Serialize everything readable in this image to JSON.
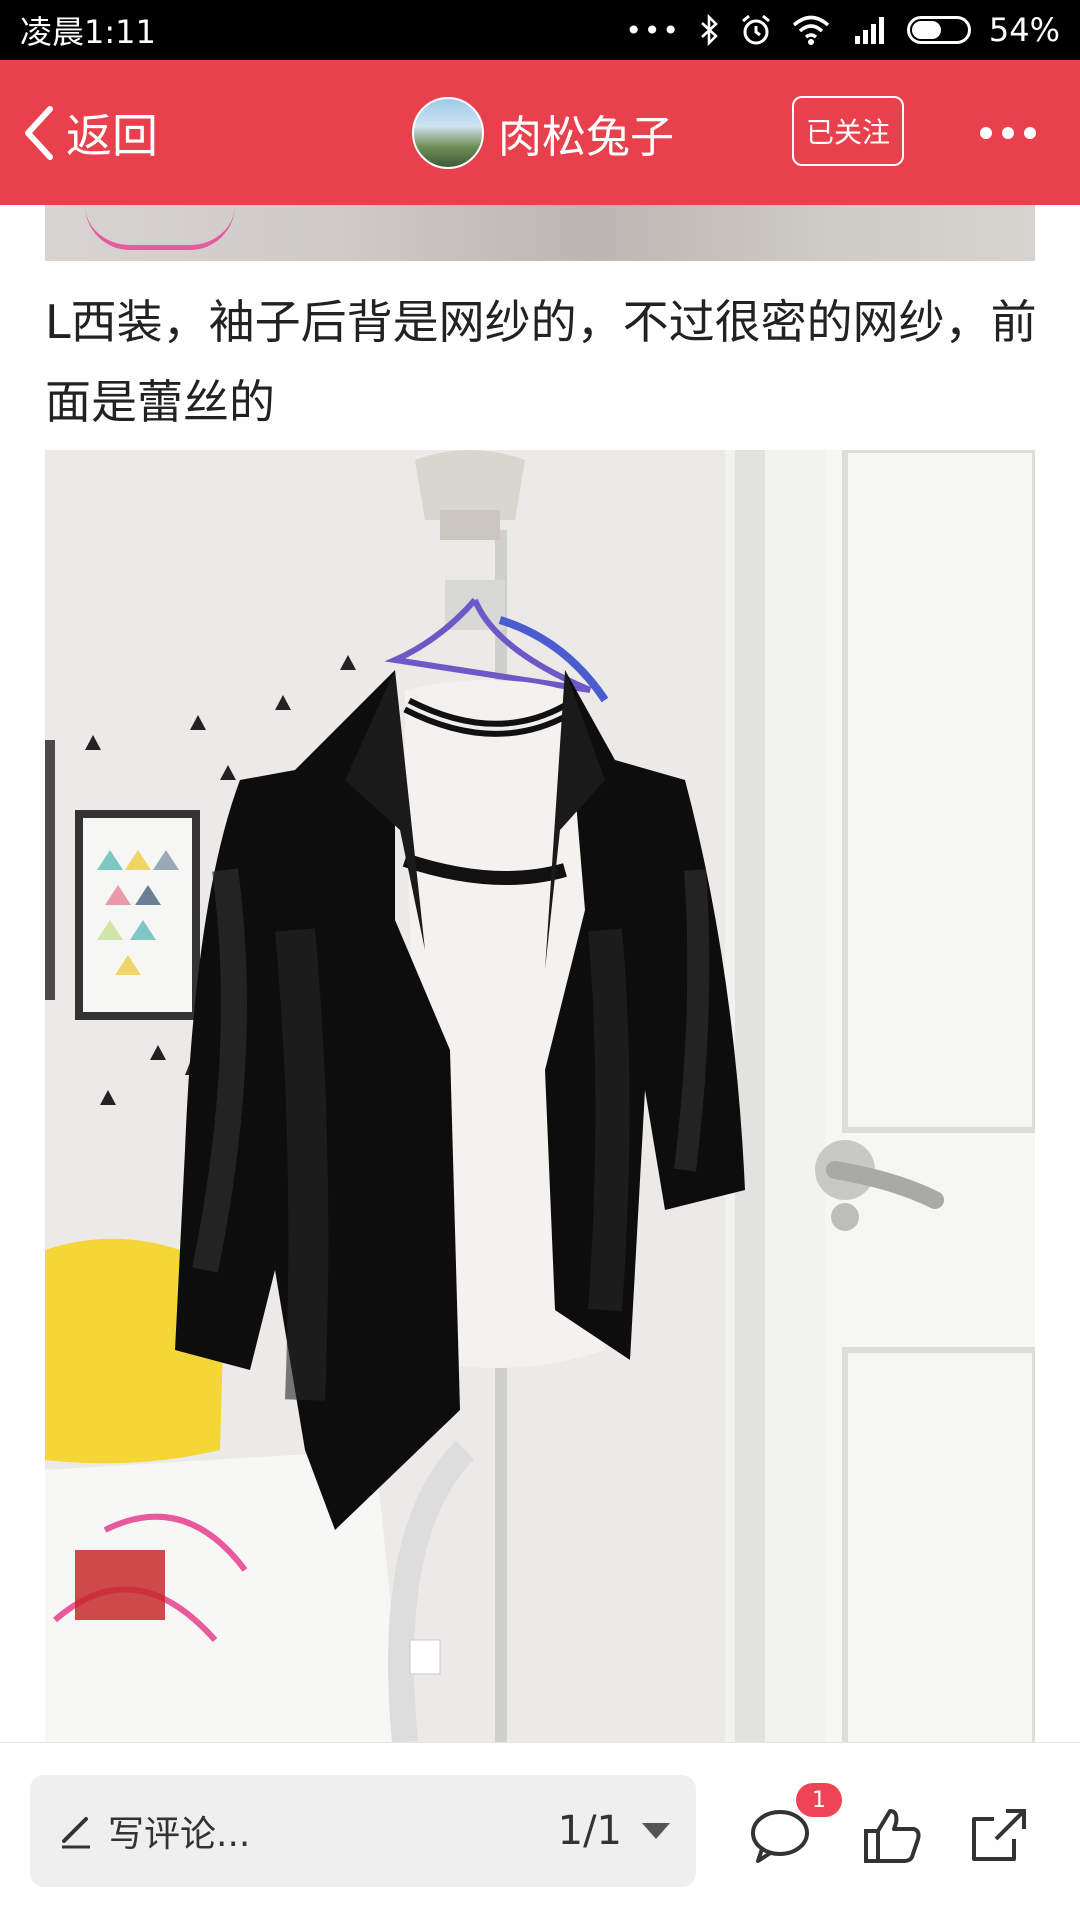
{
  "status_bar": {
    "time": "凌晨1:11",
    "dots": "•••",
    "battery_percent": "54%",
    "battery_level": 0.54
  },
  "header": {
    "back_label": "返回",
    "author_name": "肉松兔子",
    "follow_label": "已关注",
    "accent_color": "#e8404c"
  },
  "post": {
    "text": "L西装，袖子后背是网纱的，不过很密的网纱，前面是蕾丝的"
  },
  "bottom_bar": {
    "comment_placeholder": "写评论...",
    "page_indicator": "1/1",
    "comment_badge": "1",
    "icons": [
      "pencil-icon",
      "comment-icon",
      "like-icon",
      "share-icon"
    ]
  }
}
